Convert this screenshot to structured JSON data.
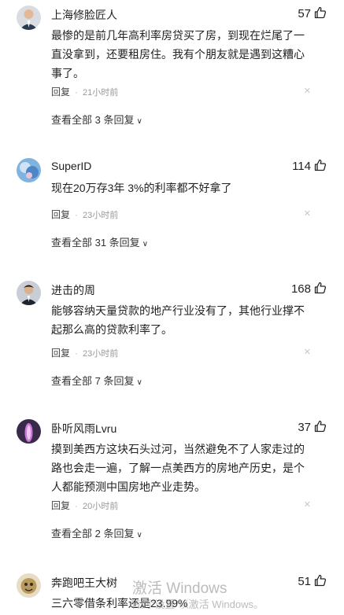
{
  "comments": [
    {
      "username": "上海修脸匠人",
      "likes": "57",
      "text": "最惨的是前几年高利率房贷买了房，到现在烂尾了一直没拿到，还要租房住。我有个朋友就是遇到这糟心事了。",
      "reply_label": "回复",
      "time": "21小时前",
      "view_all": "查看全部 3 条回复"
    },
    {
      "username": "SuperID",
      "likes": "114",
      "text": "现在20万存3年 3%的利率都不好拿了",
      "reply_label": "回复",
      "time": "23小时前",
      "view_all": "查看全部 31 条回复"
    },
    {
      "username": "进击的周",
      "likes": "168",
      "text": "能够容纳天量贷款的地产行业没有了，其他行业撑不起那么高的贷款利率了。",
      "reply_label": "回复",
      "time": "23小时前",
      "view_all": "查看全部 7 条回复"
    },
    {
      "username": "卧听风雨Lvru",
      "likes": "37",
      "text": "摸到美西方这块石头过河，当然避免不了人家走过的路也会走一遍，了解一点美西方的房地产历史，是个人都能预测中国房地产业走势。",
      "reply_label": "回复",
      "time": "20小时前",
      "view_all": "查看全部 2 条回复"
    },
    {
      "username": "奔跑吧王大树",
      "likes": "51",
      "text": "三六零借条利率还是23.99%"
    }
  ],
  "icons": {
    "like": "thumbs-up-icon",
    "close": "close-icon",
    "expand": "chevron-down-icon"
  },
  "watermark": {
    "title": "激活 Windows",
    "subtitle": "转到“设置”以激活 Windows。"
  }
}
